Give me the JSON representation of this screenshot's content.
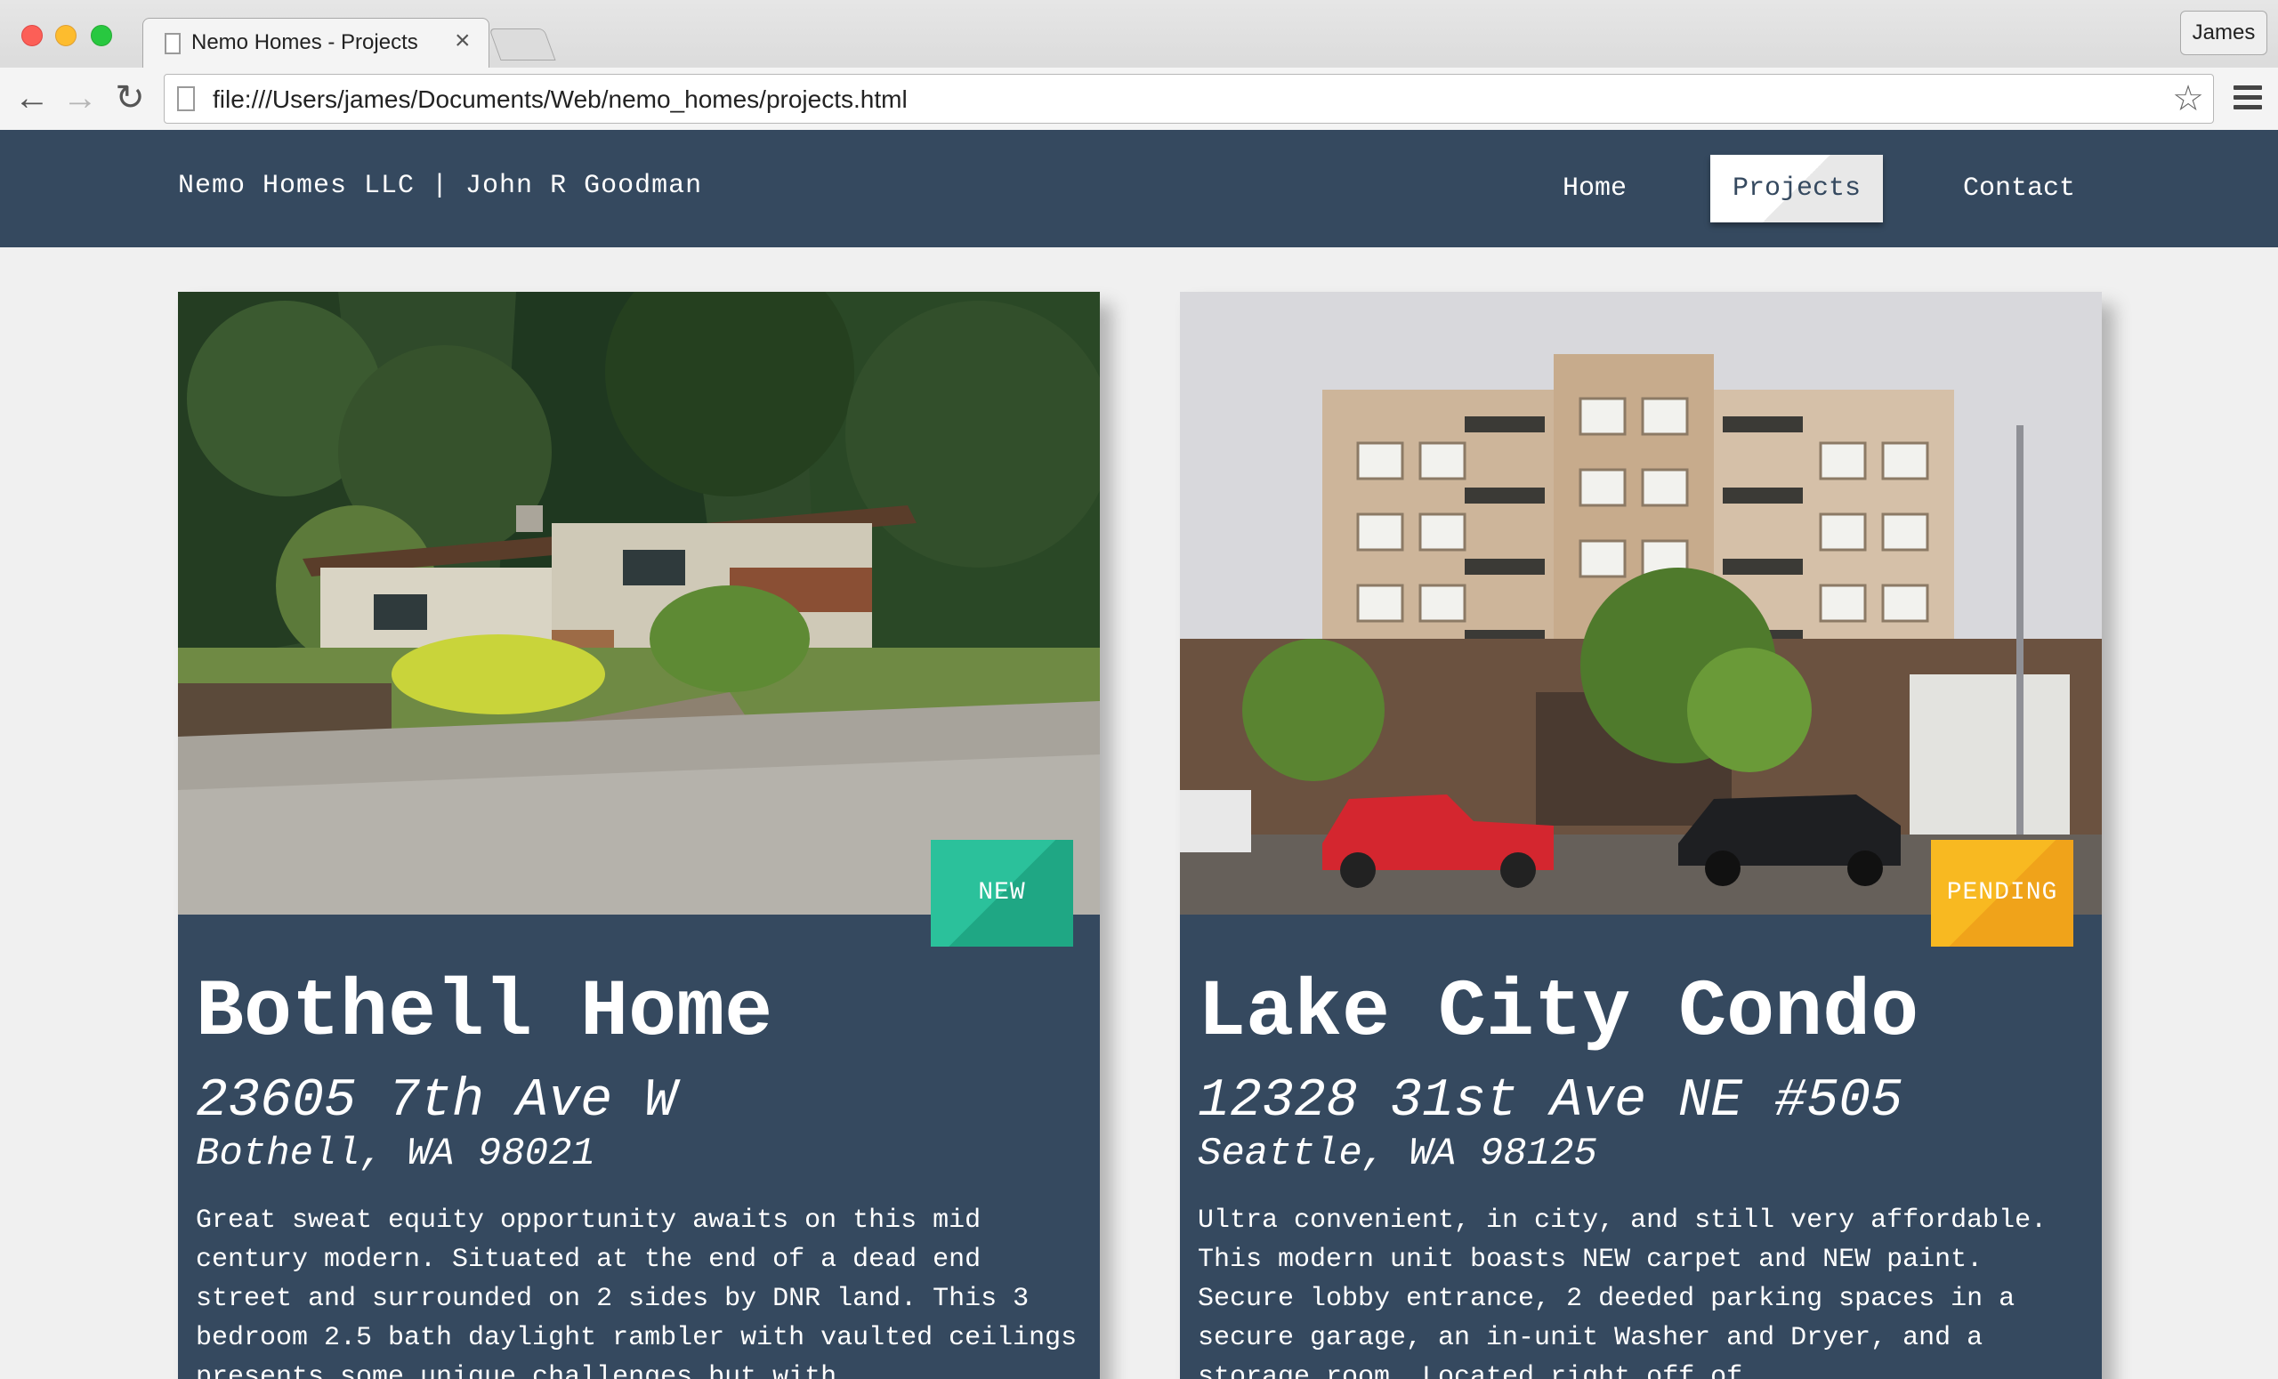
{
  "browser": {
    "tab_title": "Nemo Homes - Projects",
    "tab_close": "×",
    "profile_name": "James",
    "url": "file:///Users/james/Documents/Web/nemo_homes/projects.html",
    "back_glyph": "←",
    "forward_glyph": "→",
    "reload_glyph": "↻",
    "star_glyph": "☆",
    "icons": [
      "close-icon",
      "minimize-icon",
      "maximize-icon",
      "document-icon",
      "back-arrow-icon",
      "forward-arrow-icon",
      "reload-icon",
      "star-icon",
      "menu-icon"
    ]
  },
  "site": {
    "brand": "Nemo Homes LLC | John R Goodman",
    "nav": {
      "home": "Home",
      "projects": "Projects",
      "contact": "Contact"
    },
    "active_nav": "Projects"
  },
  "projects": [
    {
      "title": "Bothell Home",
      "address_line1": "23605 7th Ave W",
      "address_line2": "Bothell, WA 98021",
      "badge": "NEW",
      "badge_color": "#2bc19b",
      "description": "Great sweat equity opportunity awaits on this mid century modern. Situated at the end of a dead end street and surrounded on 2 sides by DNR land. This 3 bedroom 2.5 bath daylight rambler with vaulted ceilings presents some unique challenges but with"
    },
    {
      "title": "Lake City Condo",
      "address_line1": "12328 31st Ave NE #505",
      "address_line2": "Seattle, WA 98125",
      "badge": "PENDING",
      "badge_color": "#f8b921",
      "description": "Ultra convenient, in city, and still very affordable. This modern unit boasts NEW carpet and NEW paint. Secure lobby entrance, 2 deeded parking spaces in a secure garage, an in-unit Washer and Dryer, and a storage room. Located right off of"
    }
  ],
  "colors": {
    "header_bg": "#35495f",
    "page_bg": "#f0f0f0"
  }
}
